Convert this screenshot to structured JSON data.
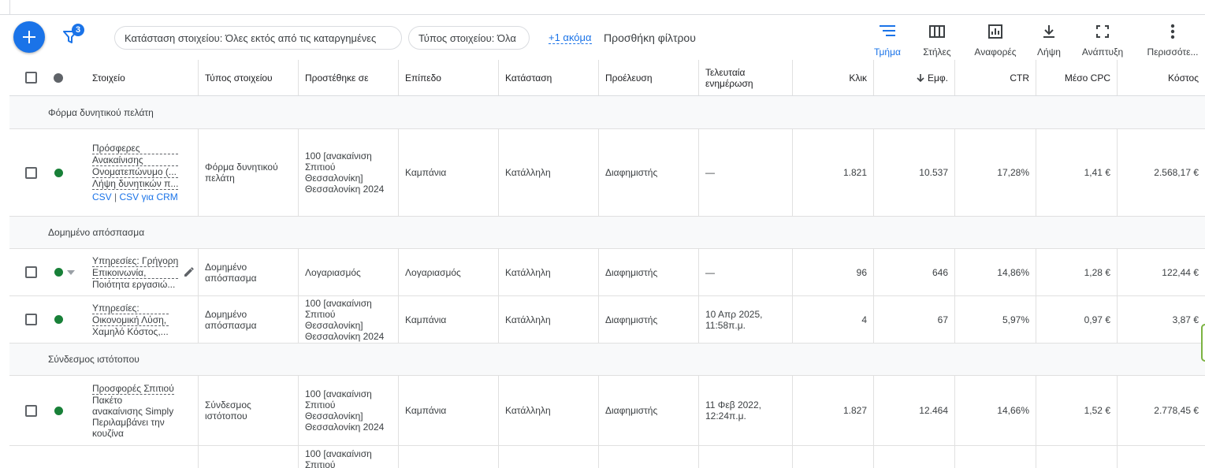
{
  "toolbar": {
    "filter_badge": "3",
    "chips": [
      "Κατάσταση στοιχείου: Όλες εκτός από τις καταργημένες",
      "Τύπος στοιχείου: Όλα"
    ],
    "more_link": "+1 ακόμα",
    "add_filter": "Προσθήκη φίλτρου",
    "tools": [
      {
        "label": "Τμήμα",
        "icon": "segment-icon"
      },
      {
        "label": "Στήλες",
        "icon": "columns-icon"
      },
      {
        "label": "Αναφορές",
        "icon": "reports-icon"
      },
      {
        "label": "Λήψη",
        "icon": "download-icon"
      },
      {
        "label": "Ανάπτυξη",
        "icon": "expand-icon"
      },
      {
        "label": "Περισσότε...",
        "icon": "more-vert-icon"
      }
    ]
  },
  "table": {
    "headers": {
      "item": "Στοιχείο",
      "type": "Τύπος στοιχείου",
      "added_to": "Προστέθηκε σε",
      "level": "Επίπεδο",
      "status": "Κατάσταση",
      "source": "Προέλευση",
      "last_update": "Τελευταία ενημέρωση",
      "clicks": "Κλικ",
      "impressions": "Εμφ.",
      "ctr": "CTR",
      "avg_cpc": "Μέσο CPC",
      "cost": "Κόστος"
    },
    "sections": [
      {
        "label": "Φόρμα δυνητικού πελάτη"
      },
      {
        "label": "Δομημένο απόσπασμα"
      },
      {
        "label": "Σύνδεσμος ιστότοπου"
      }
    ],
    "rows": [
      {
        "item_line1": "Πρόσφερες",
        "item_line2": "Ανακαίνισης",
        "item_line3": "Ονοματεπώνυμο (...",
        "item_line4": "Λήψη δυνητικών π...",
        "link_csv": "CSV",
        "link_sep": "|",
        "link_crm": "CSV για CRM",
        "type": "Φόρμα δυνητικού πελάτη",
        "added_to": "100 [ανακαίνιση Σπιτιού Θεσσαλονίκη] Θεσσαλονίκη 2024",
        "level": "Καμπάνια",
        "status": "Κατάλληλη",
        "source": "Διαφημιστής",
        "last_update": "—",
        "clicks": "1.821",
        "impressions": "10.537",
        "ctr": "17,28%",
        "avg_cpc": "1,41 €",
        "cost": "2.568,17 €"
      },
      {
        "item_line1": "Υπηρεσίες: Γρήγορη",
        "item_line2": "Επικοινωνία,",
        "item_line3": "Ποιότητα εργασιώ...",
        "type": "Δομημένο απόσπασμα",
        "added_to": "Λογαριασμός",
        "level": "Λογαριασμός",
        "status": "Κατάλληλη",
        "source": "Διαφημιστής",
        "last_update": "—",
        "clicks": "96",
        "impressions": "646",
        "ctr": "14,86%",
        "avg_cpc": "1,28 €",
        "cost": "122,44 €"
      },
      {
        "item_line1": "Υπηρεσίες:",
        "item_line2": "Οικονομική Λύση,",
        "item_line3": "Χαμηλό Κόστος,...",
        "type": "Δομημένο απόσπασμα",
        "added_to": "100 [ανακαίνιση Σπιτιού Θεσσαλονίκη] Θεσσαλονίκη 2024",
        "level": "Καμπάνια",
        "status": "Κατάλληλη",
        "source": "Διαφημιστής",
        "last_update": "10 Απρ 2025, 11:58π.μ.",
        "clicks": "4",
        "impressions": "67",
        "ctr": "5,97%",
        "avg_cpc": "0,97 €",
        "cost": "3,87 €"
      },
      {
        "item_line1": "Προσφορές Σπιτιού",
        "item_line2": "Πακέτο",
        "item_line3": "ανακαίνισης Simply",
        "item_line4": "Περιλαμβάνει την",
        "item_line5": "κουζίνα",
        "type": "Σύνδεσμος ιστότοπου",
        "added_to": "100 [ανακαίνιση Σπιτιού Θεσσαλονίκη] Θεσσαλονίκη 2024",
        "level": "Καμπάνια",
        "status": "Κατάλληλη",
        "source": "Διαφημιστής",
        "last_update": "11 Φεβ 2022, 12:24π.μ.",
        "clicks": "1.827",
        "impressions": "12.464",
        "ctr": "14,66%",
        "avg_cpc": "1,52 €",
        "cost": "2.778,45 €"
      },
      {
        "added_to": "100 [ανακαίνιση Σπιτιού"
      }
    ]
  }
}
